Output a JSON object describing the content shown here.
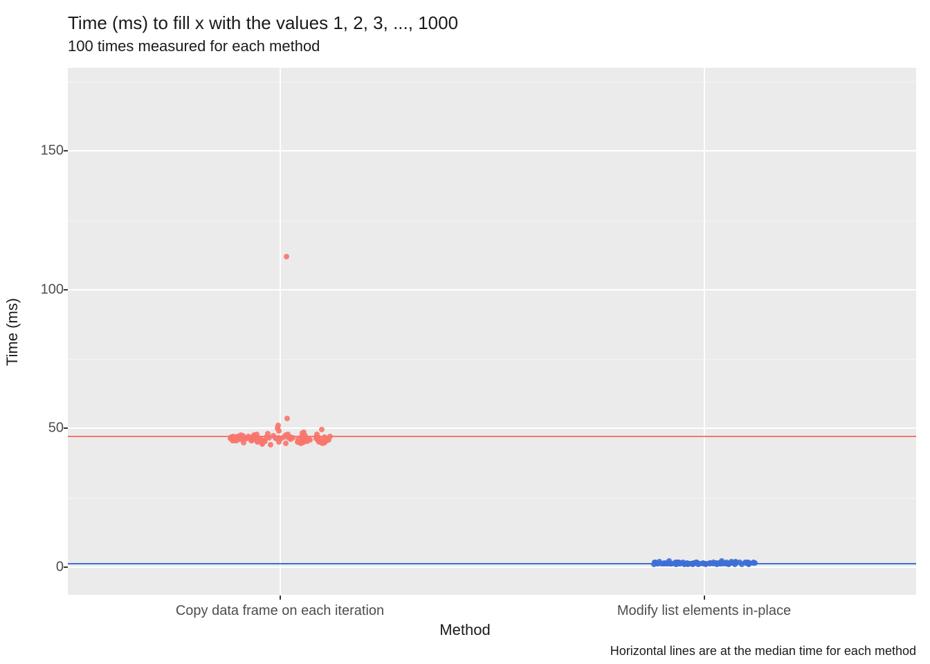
{
  "chart_data": {
    "type": "scatter",
    "title": "Time (ms) to fill x with the values 1, 2, 3, ..., 1000",
    "subtitle": "100 times measured for each method",
    "caption": "Horizontal lines are at the median time for each method",
    "xlabel": "Method",
    "ylabel": "Time (ms)",
    "ylim": [
      -10,
      180
    ],
    "y_ticks": [
      0,
      50,
      100,
      150
    ],
    "categories": [
      "Copy data frame on each iteration",
      "Modify list elements in-place"
    ],
    "jitter_width": 0.12,
    "colors": {
      "copy": "#F8766D",
      "inplace": "#3E6FD6"
    },
    "medians": [
      {
        "method": "Copy data frame on each iteration",
        "value": 47,
        "color": "#F8766D"
      },
      {
        "method": "Modify list elements in-place",
        "value": 1.3,
        "color": "#3E6FD6"
      }
    ],
    "series": [
      {
        "name": "Copy data frame on each iteration",
        "color": "#F8766D",
        "values": [
          44.1,
          45.7,
          46.9,
          46.6,
          45.2,
          44.9,
          46.0,
          47.4,
          46.4,
          44.7,
          45.3,
          48.3,
          48.7,
          46.1,
          46.3,
          45.1,
          47.3,
          46.6,
          45.7,
          44.8,
          44.9,
          46.9,
          45.6,
          46.3,
          46.8,
          47.8,
          45.1,
          45.4,
          44.6,
          46.5,
          49.1,
          47.7,
          46.5,
          45.0,
          45.2,
          47.0,
          46.8,
          46.3,
          45.6,
          47.1,
          46.9,
          45.8,
          46.1,
          44.5,
          46.6,
          47.9,
          46.2,
          45.9,
          46.7,
          47.5,
          45.3,
          46.0,
          45.7,
          44.8,
          47.8,
          46.4,
          46.9,
          45.5,
          46.2,
          47.2,
          44.4,
          45.9,
          46.1,
          47.6,
          45.8,
          46.6,
          45.0,
          46.3,
          47.0,
          46.8,
          45.4,
          46.2,
          47.3,
          44.7,
          46.5,
          45.6,
          47.1,
          46.0,
          46.8,
          45.3,
          47.4,
          46.5,
          45.2,
          49.5,
          46.9,
          48.2,
          46.3,
          45.7,
          46.4,
          50.2,
          46.1,
          45.8,
          47.0,
          46.6,
          51.0,
          46.2,
          45.5,
          53.5,
          46.7,
          112.0
        ]
      },
      {
        "name": "Modify list elements in-place",
        "color": "#3E6FD6",
        "values": [
          1.0,
          1.6,
          1.2,
          2.2,
          1.1,
          1.3,
          1.5,
          1.4,
          1.7,
          1.0,
          1.9,
          1.1,
          1.6,
          1.3,
          1.4,
          1.2,
          2.0,
          1.5,
          1.1,
          1.3,
          1.0,
          1.7,
          1.4,
          1.2,
          1.8,
          1.6,
          1.1,
          1.3,
          1.5,
          1.0,
          1.2,
          1.4,
          1.9,
          1.1,
          1.3,
          1.6,
          1.4,
          1.0,
          1.2,
          1.5,
          1.3,
          1.7,
          1.1,
          1.4,
          1.2,
          1.6,
          1.0,
          1.3,
          1.5,
          1.1,
          1.4,
          1.2,
          1.8,
          1.3,
          1.0,
          1.6,
          1.2,
          1.5,
          1.1,
          1.4,
          1.3,
          1.7,
          1.0,
          1.2,
          1.5,
          1.4,
          1.1,
          1.6,
          1.3,
          1.2,
          1.0,
          1.5,
          1.4,
          1.8,
          1.1,
          1.3,
          1.2,
          1.6,
          1.0,
          1.4,
          1.5,
          1.3,
          1.1,
          1.7,
          1.2,
          1.4,
          1.0,
          1.6,
          1.3,
          1.5,
          1.1,
          1.2,
          1.4,
          1.0,
          1.8,
          1.3,
          1.5,
          1.1,
          1.2,
          2.3
        ]
      }
    ]
  }
}
